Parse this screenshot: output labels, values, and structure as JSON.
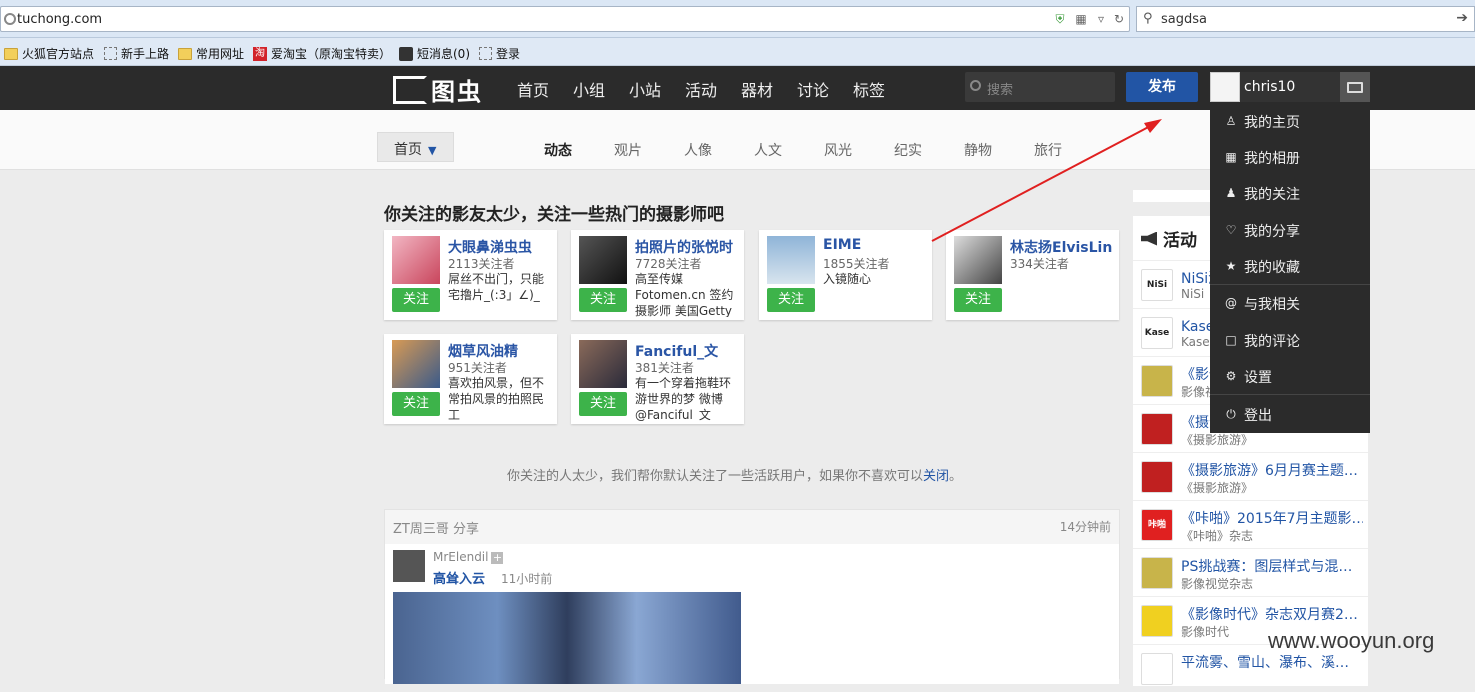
{
  "browser": {
    "url": "tuchong.com",
    "search_value": "sagdsa",
    "bookmarks": [
      "火狐官方站点",
      "新手上路",
      "常用网址",
      "爱淘宝（原淘宝特卖）",
      "短消息(0)",
      "登录"
    ],
    "taobao_icon": "淘"
  },
  "site": {
    "logo": "图虫",
    "nav": [
      "首页",
      "小组",
      "小站",
      "活动",
      "器材",
      "讨论",
      "标签"
    ],
    "search_placeholder": "搜索",
    "publish": "发布",
    "username": "chris10"
  },
  "subnav": {
    "home_dropdown": "首页",
    "tabs": [
      "动态",
      "观片",
      "人像",
      "人文",
      "风光",
      "纪实",
      "静物",
      "旅行"
    ],
    "active_tab": "动态"
  },
  "main": {
    "heading": "你关注的影友太少，关注一些热门的摄影师吧",
    "follow_label": "关注",
    "photographers": [
      {
        "name": "大眼鼻涕虫虫",
        "followers": "2113关注者",
        "desc": "屌丝不出门，只能宅撸片_(:3」∠)_"
      },
      {
        "name": "拍照片的张悦时",
        "followers": "7728关注者",
        "desc": "高至传媒Fotomen.cn 签约摄影师 美国Getty"
      },
      {
        "name": "EIME",
        "followers": "1855关注者",
        "desc": "入镜随心"
      },
      {
        "name": "林志扬ElvisLin",
        "followers": "334关注者",
        "desc": ""
      },
      {
        "name": "烟草风油精",
        "followers": "951关注者",
        "desc": "喜欢拍风景，但不常拍风景的拍照民工"
      },
      {
        "name": "Fanciful_文",
        "followers": "381关注者",
        "desc": "有一个穿着拖鞋环游世界的梦 微博@Fanciful_文"
      }
    ],
    "notice": "你关注的人太少，我们帮你默认关注了一些活跃用户，如果你不喜欢可以",
    "notice_link": "关闭",
    "notice_end": "。",
    "feed": {
      "header": "ZT周三哥 分享",
      "time": "14分钟前",
      "user": "MrElendil",
      "plus": "+",
      "title": "高耸入云",
      "ago": "11小时前"
    }
  },
  "activities": {
    "title": "活动",
    "items": [
      {
        "title": "NiSi滤镜",
        "sub": "NiSi",
        "logo_text": "NiSi",
        "color": "#ffffff"
      },
      {
        "title": "Kase滤镜",
        "sub": "Kase",
        "logo_text": "Kase",
        "color": "#ffffff"
      },
      {
        "title": "《影像视觉》",
        "sub": "影像视觉",
        "logo_text": "",
        "color": "#c8b44a"
      },
      {
        "title": "《摄影旅游》",
        "sub": "《摄影旅游》",
        "logo_text": "",
        "color": "#c02020"
      },
      {
        "title": "《摄影旅游》6月月赛主题…",
        "sub": "《摄影旅游》",
        "logo_text": "",
        "color": "#c02020"
      },
      {
        "title": "《咔啪》2015年7月主题影…",
        "sub": "《咔啪》杂志",
        "logo_text": "咔啪",
        "color": "#e02020"
      },
      {
        "title": "PS挑战赛：图层样式与混…",
        "sub": "影像视觉杂志",
        "logo_text": "",
        "color": "#c8b44a"
      },
      {
        "title": "《影像时代》杂志双月赛2…",
        "sub": "影像时代",
        "logo_text": "",
        "color": "#f0d020"
      },
      {
        "title": "平流雾、雪山、瀑布、溪…",
        "sub": "",
        "logo_text": "",
        "color": "#ffffff"
      }
    ]
  },
  "user_menu": [
    {
      "label": "我的主页",
      "icon": "person-icon"
    },
    {
      "label": "我的相册",
      "icon": "album-icon"
    },
    {
      "label": "我的关注",
      "icon": "follow-icon"
    },
    {
      "label": "我的分享",
      "icon": "heart-icon"
    },
    {
      "label": "我的收藏",
      "icon": "star-icon"
    },
    {
      "label": "与我相关",
      "icon": "at-icon"
    },
    {
      "label": "我的评论",
      "icon": "comment-icon"
    },
    {
      "label": "设置",
      "icon": "gear-icon"
    },
    {
      "label": "登出",
      "icon": "power-icon"
    }
  ],
  "watermark": "www.wooyun.org",
  "colors": {
    "accent": "#2255a5",
    "follow": "#3db34a",
    "arrow": "#e02020"
  }
}
